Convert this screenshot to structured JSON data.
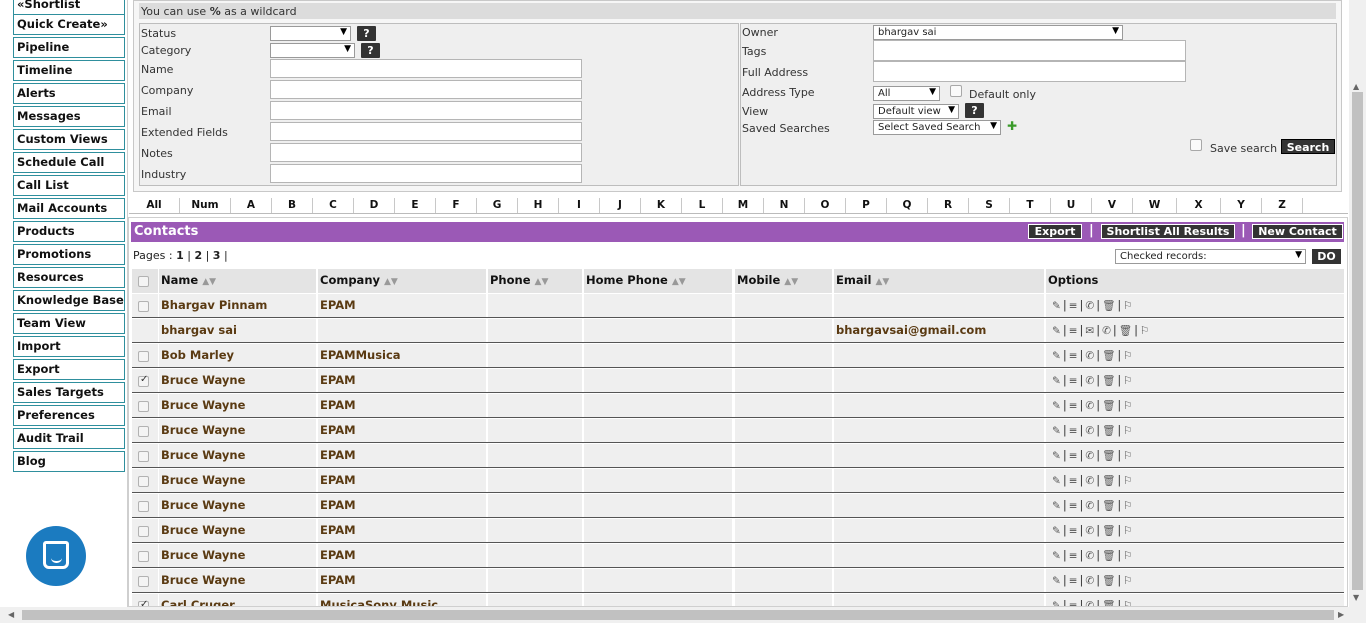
{
  "sidebar": {
    "items": [
      {
        "label": "«Shortlist"
      },
      {
        "label": "Quick Create»"
      },
      {
        "label": "Pipeline"
      },
      {
        "label": "Timeline"
      },
      {
        "label": "Alerts"
      },
      {
        "label": "Messages"
      },
      {
        "label": "Custom Views"
      },
      {
        "label": "Schedule Call"
      },
      {
        "label": "Call List"
      },
      {
        "label": "Mail Accounts"
      },
      {
        "label": "Products"
      },
      {
        "label": "Promotions"
      },
      {
        "label": "Resources"
      },
      {
        "label": "Knowledge Base"
      },
      {
        "label": "Team View"
      },
      {
        "label": "Import"
      },
      {
        "label": "Export"
      },
      {
        "label": "Sales Targets"
      },
      {
        "label": "Preferences"
      },
      {
        "label": "Audit Trail"
      },
      {
        "label": "Blog"
      }
    ]
  },
  "search": {
    "wildcard_prefix": "You can use ",
    "wildcard_symbol": "%",
    "wildcard_suffix": " as a wildcard",
    "help_label": "?",
    "labels": {
      "status": "Status",
      "category": "Category",
      "name": "Name",
      "company": "Company",
      "email": "Email",
      "extended_fields": "Extended Fields",
      "notes": "Notes",
      "industry": "Industry",
      "owner": "Owner",
      "tags": "Tags",
      "full_address": "Full Address",
      "address_type": "Address Type",
      "view": "View",
      "saved_searches": "Saved Searches"
    },
    "owner_value": "bhargav sai",
    "address_type_value": "All",
    "default_only_label": "Default only",
    "view_value": "Default view",
    "saved_search_value": "Select Saved Search",
    "save_search_label": "Save search",
    "search_button": "Search"
  },
  "alphabet": [
    "All",
    "Num",
    "A",
    "B",
    "C",
    "D",
    "E",
    "F",
    "G",
    "H",
    "I",
    "J",
    "K",
    "L",
    "M",
    "N",
    "O",
    "P",
    "Q",
    "R",
    "S",
    "T",
    "U",
    "V",
    "W",
    "X",
    "Y",
    "Z"
  ],
  "contacts": {
    "title": "Contacts",
    "export_button": "Export",
    "shortlist_button": "Shortlist All Results",
    "new_contact_button": "New Contact",
    "separator": "|",
    "pages_label": "Pages :",
    "pages": [
      "1",
      "2",
      "3"
    ],
    "checked_records_value": "Checked records:",
    "do_button": "DO",
    "columns": {
      "name": "Name",
      "company": "Company",
      "phone": "Phone",
      "home_phone": "Home Phone",
      "mobile": "Mobile",
      "email": "Email",
      "options": "Options"
    },
    "sort_glyph": "▲▼",
    "rows": [
      {
        "name": "Bhargav Pinnam",
        "company": "EPAM",
        "email": "",
        "checked": false,
        "show_checkbox": true,
        "mail_icon": false
      },
      {
        "name": "bhargav sai",
        "company": "",
        "email": "bhargavsai@gmail.com",
        "checked": false,
        "show_checkbox": false,
        "mail_icon": true
      },
      {
        "name": "Bob Marley",
        "company": "EPAMMusica",
        "email": "",
        "checked": false,
        "show_checkbox": true,
        "mail_icon": false
      },
      {
        "name": "Bruce Wayne",
        "company": "EPAM",
        "email": "",
        "checked": true,
        "show_checkbox": true,
        "mail_icon": false
      },
      {
        "name": "Bruce Wayne",
        "company": "EPAM",
        "email": "",
        "checked": false,
        "show_checkbox": true,
        "mail_icon": false
      },
      {
        "name": "Bruce Wayne",
        "company": "EPAM",
        "email": "",
        "checked": false,
        "show_checkbox": true,
        "mail_icon": false
      },
      {
        "name": "Bruce Wayne",
        "company": "EPAM",
        "email": "",
        "checked": false,
        "show_checkbox": true,
        "mail_icon": false
      },
      {
        "name": "Bruce Wayne",
        "company": "EPAM",
        "email": "",
        "checked": false,
        "show_checkbox": true,
        "mail_icon": false
      },
      {
        "name": "Bruce Wayne",
        "company": "EPAM",
        "email": "",
        "checked": false,
        "show_checkbox": true,
        "mail_icon": false
      },
      {
        "name": "Bruce Wayne",
        "company": "EPAM",
        "email": "",
        "checked": false,
        "show_checkbox": true,
        "mail_icon": false
      },
      {
        "name": "Bruce Wayne",
        "company": "EPAM",
        "email": "",
        "checked": false,
        "show_checkbox": true,
        "mail_icon": false
      },
      {
        "name": "Bruce Wayne",
        "company": "EPAM",
        "email": "",
        "checked": false,
        "show_checkbox": true,
        "mail_icon": false
      },
      {
        "name": "Carl Cruger",
        "company": "MusicaSony Music",
        "email": "",
        "checked": true,
        "show_checkbox": true,
        "mail_icon": false
      }
    ]
  },
  "icons": {
    "edit": "edit-icon",
    "list": "list-icon",
    "mail": "mail-icon",
    "phone": "phone-icon",
    "trash": "trash-icon",
    "flag": "flag-icon",
    "chat": "chat-icon",
    "pin": "pin-icon"
  },
  "colors": {
    "contacts_header": "#9b59b6",
    "link_text": "#5a3a12",
    "sidebar_border": "#2f8f9d",
    "button_dark": "#333333",
    "chat_bubble": "#1b7bc0"
  }
}
